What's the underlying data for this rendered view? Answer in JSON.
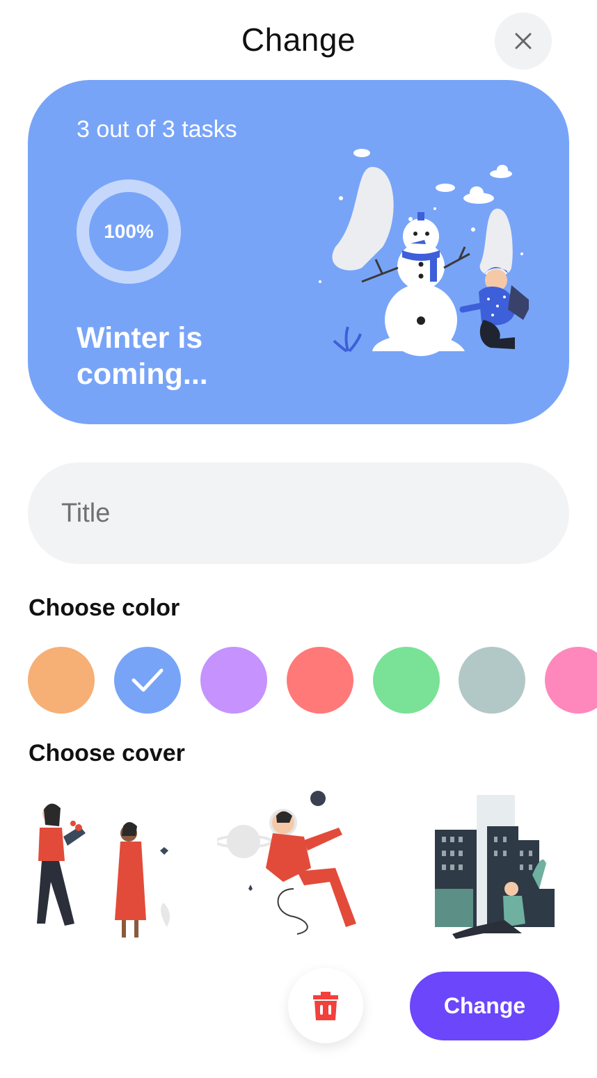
{
  "header": {
    "title": "Change",
    "close_icon": "close-icon"
  },
  "card": {
    "tasks_text": "3 out of 3 tasks",
    "progress_fraction": 1.0,
    "progress_label": "100%",
    "title": "Winter is coming...",
    "background_color": "#78a4f8"
  },
  "title_field": {
    "placeholder": "Title",
    "value": ""
  },
  "color_section": {
    "label": "Choose color",
    "colors": [
      "#f6af75",
      "#78a4f8",
      "#c592fe",
      "#fe7978",
      "#79e297",
      "#b2c8c6",
      "#fe88bc"
    ],
    "selected_index": 1
  },
  "cover_section": {
    "label": "Choose cover",
    "covers": [
      "couple-illustration",
      "astronaut-illustration",
      "city-illustration"
    ]
  },
  "actions": {
    "delete_icon": "trash-icon",
    "delete_color": "#f2403c",
    "change_label": "Change",
    "change_color": "#6b46fb"
  }
}
